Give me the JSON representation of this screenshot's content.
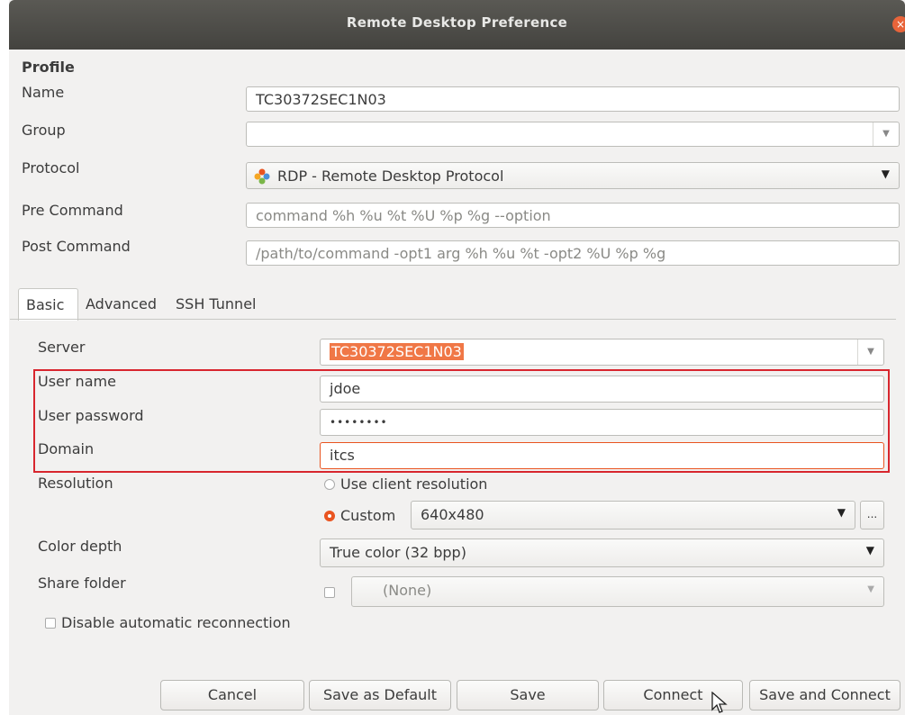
{
  "window": {
    "title": "Remote Desktop Preference",
    "close_glyph": "×"
  },
  "profile": {
    "section_label": "Profile",
    "name_label": "Name",
    "name_value": "TC30372SEC1N03",
    "group_label": "Group",
    "group_value": "",
    "protocol_label": "Protocol",
    "protocol_value": "RDP - Remote Desktop Protocol",
    "protocol_icon": "rdp-plugin-icon",
    "pre_command_label": "Pre Command",
    "pre_command_placeholder": "command %h %u %t %U %p %g --option",
    "post_command_label": "Post Command",
    "post_command_placeholder": "/path/to/command -opt1 arg %h %u %t -opt2 %U %p %g"
  },
  "tabs": [
    {
      "label": "Basic",
      "active": true
    },
    {
      "label": "Advanced",
      "active": false
    },
    {
      "label": "SSH Tunnel",
      "active": false
    }
  ],
  "basic": {
    "server_label": "Server",
    "server_value": "TC30372SEC1N03",
    "username_label": "User name",
    "username_value": "jdoe",
    "password_label": "User password",
    "password_value": "••••••••",
    "domain_label": "Domain",
    "domain_value": "itcs",
    "resolution_label": "Resolution",
    "resolution_option_client": "Use client resolution",
    "resolution_option_custom": "Custom",
    "resolution_custom_value": "640x480",
    "resolution_more_label": "...",
    "color_depth_label": "Color depth",
    "color_depth_value": "True color (32 bpp)",
    "share_folder_label": "Share folder",
    "share_folder_value": "(None)",
    "disable_reconnect_label": "Disable automatic reconnection"
  },
  "buttons": {
    "cancel": "Cancel",
    "save_default": "Save as Default",
    "save": "Save",
    "connect": "Connect",
    "save_connect": "Save and Connect"
  },
  "colors": {
    "accent": "#e95420",
    "highlight_border": "#d8262e",
    "selection": "#f07746",
    "titlebar": "#4d4c48"
  }
}
